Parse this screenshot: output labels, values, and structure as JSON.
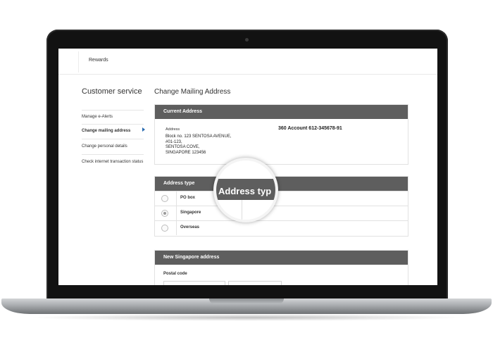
{
  "topbar": {
    "rewards": "Rewards"
  },
  "sidebar": {
    "title": "Customer service",
    "items": [
      {
        "label": "Manage e-Alerts"
      },
      {
        "label": "Change mailing address"
      },
      {
        "label": "Change personal details"
      },
      {
        "label": "Check internet transaction status"
      }
    ]
  },
  "main": {
    "title": "Change Mailing Address",
    "current_address": {
      "header": "Current Address",
      "label": "Address",
      "lines": "Block no. 123 SENTOSA AVENUE,\n#01-123,\nSENTOSA COVE,\nSINGAPORE 123456",
      "account": "360 Account 612-345678-91"
    },
    "address_type": {
      "header": "Address type",
      "options": [
        {
          "label": "PO box",
          "selected": false
        },
        {
          "label": "Singapore",
          "selected": true
        },
        {
          "label": "Overseas",
          "selected": false
        }
      ]
    },
    "new_address": {
      "header": "New Singapore address",
      "postal_label": "Postal code"
    },
    "magnifier_text": "Address typ"
  }
}
